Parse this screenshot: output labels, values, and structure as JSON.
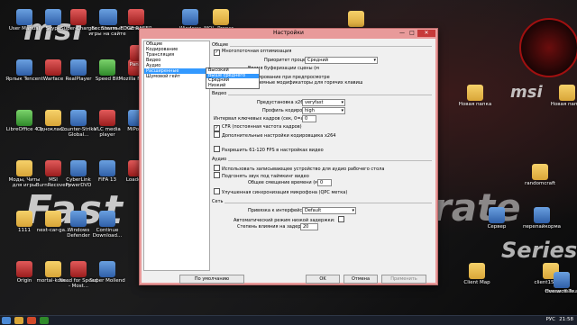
{
  "wallpaper": {
    "brand": "msi",
    "word1": "Fast",
    "word2": "rate",
    "word3": "Series",
    "brand_right": "msi"
  },
  "desktop_icons": [
    {
      "label": "User Manual",
      "kind": "app"
    },
    {
      "label": "Ярлык Tencent",
      "kind": "app"
    },
    {
      "label": "LibreOffice 4.1",
      "kind": "green"
    },
    {
      "label": "Моды, Читы для игры",
      "kind": "folder"
    },
    {
      "label": "1111",
      "kind": "folder"
    },
    {
      "label": "Origin",
      "kind": "red"
    },
    {
      "label": "Skype",
      "kind": "app"
    },
    {
      "label": "Warface",
      "kind": "red"
    },
    {
      "label": "Однокласс...",
      "kind": "folder"
    },
    {
      "label": "MSI BurnRecovery",
      "kind": "red"
    },
    {
      "label": "next-car-ga...",
      "kind": "folder"
    },
    {
      "label": "mortal-kom...",
      "kind": "folder"
    },
    {
      "label": "Super-Charger",
      "kind": "red"
    },
    {
      "label": "RealPlayer",
      "kind": "app"
    },
    {
      "label": "Counter-Strike Global...",
      "kind": "app"
    },
    {
      "label": "CyberLink PowerDVD",
      "kind": "app"
    },
    {
      "label": "Windows Defender",
      "kind": "app"
    },
    {
      "label": "Need for Speed - Most...",
      "kind": "red"
    },
    {
      "label": "Бесплатные игры на сайте",
      "kind": "app"
    },
    {
      "label": "Speed Bit",
      "kind": "green"
    },
    {
      "label": "VLC media player",
      "kind": "red"
    },
    {
      "label": "FIFA 13",
      "kind": "app"
    },
    {
      "label": "Continue Download...",
      "kind": "app"
    },
    {
      "label": "Super Mollend",
      "kind": "app"
    },
    {
      "label": "hamachi",
      "kind": "app"
    },
    {
      "label": "Mozilla Firefox",
      "kind": "red"
    },
    {
      "label": "MiPony",
      "kind": "app"
    },
    {
      "label": "Loadout",
      "kind": "red"
    },
    {
      "label": "Steam",
      "kind": "app"
    },
    {
      "label": "EDGE RACER",
      "kind": "red"
    },
    {
      "label": "Windows Defender",
      "kind": "app"
    },
    {
      "label": "MOL_Proper...",
      "kind": "folder"
    },
    {
      "label": "Panzar",
      "kind": "red"
    },
    {
      "label": "Новая папка",
      "kind": "folder"
    },
    {
      "label": "Новая папка",
      "kind": "folder"
    },
    {
      "label": "randomcraft",
      "kind": "folder"
    },
    {
      "label": "Сервер",
      "kind": "app"
    },
    {
      "label": "перепайкорма",
      "kind": "app"
    },
    {
      "label": "Client Map",
      "kind": "folder"
    },
    {
      "label": "client152_2...",
      "kind": "folder"
    },
    {
      "label": "client164_...",
      "kind": "folder"
    },
    {
      "label": "minecraft (1)",
      "kind": "folder"
    },
    {
      "label": "Новая папка",
      "kind": "folder"
    },
    {
      "label": "Overwolf Te...",
      "kind": "app"
    }
  ],
  "dialog": {
    "title": "Настройки",
    "close": "✕",
    "min": "—",
    "max": "□",
    "nav": [
      "Общие",
      "Кодирование",
      "Трансляция",
      "Видео",
      "Аудио",
      "Расширенные",
      "Шумовой гейт"
    ],
    "nav_selected_index": 5,
    "general": {
      "title": "Общие",
      "multithread": "Многопоточная оптимизация",
      "priority_label": "Приоритет процесса",
      "priority_value": "Средний",
      "buffer_label": "Время буферизации сцены (м",
      "disable_encoding": "Отключить кодирование при предпросмотре",
      "allow_modifiers": "Разрешить системные модификаторы для горячих клавиш"
    },
    "priority_options": [
      "Высокий",
      "Выше среднего",
      "Средний",
      "Низкий"
    ],
    "priority_highlight": 1,
    "video": {
      "title": "Видео",
      "preset_label": "Предустановка x264 CPU:",
      "preset_value": "veryfast",
      "profile_label": "Профиль кодирования:",
      "profile_value": "high",
      "keyframe_label": "Интервал ключевых кадров (сек, 0=авто):",
      "keyframe_value": "0",
      "cfr": "CFR (постоянная частота кадров)",
      "custom_x264": "Дополнительные настройки кодировщика x264",
      "fps_120": "Разрешить 61-120 FPS в настройках видео"
    },
    "audio": {
      "title": "Аудио",
      "use_input": "Использовать записывающее устройство для аудио рабочего стола",
      "sync_fix": "Подгонять звук под таймкинг видео",
      "offset_label": "Общее смещение времени (мс):",
      "offset_value": "0",
      "mic_sync": "Улучшенная синхронизация микрофона (QPC метка)"
    },
    "network": {
      "title": "Сеть",
      "bind_label": "Привязка к интерфейсу:",
      "bind_value": "Default",
      "auto_low_latency": "Автоматический режим низкой задержки:",
      "latency_factor_label": "Степень влияния на задержку:",
      "latency_factor_value": "20"
    },
    "buttons": {
      "defaults": "По умолчанию",
      "ok": "OK",
      "cancel": "Отмена",
      "apply": "Применить"
    }
  },
  "taskbar": {
    "lang": "РУС",
    "time": "21:58"
  }
}
